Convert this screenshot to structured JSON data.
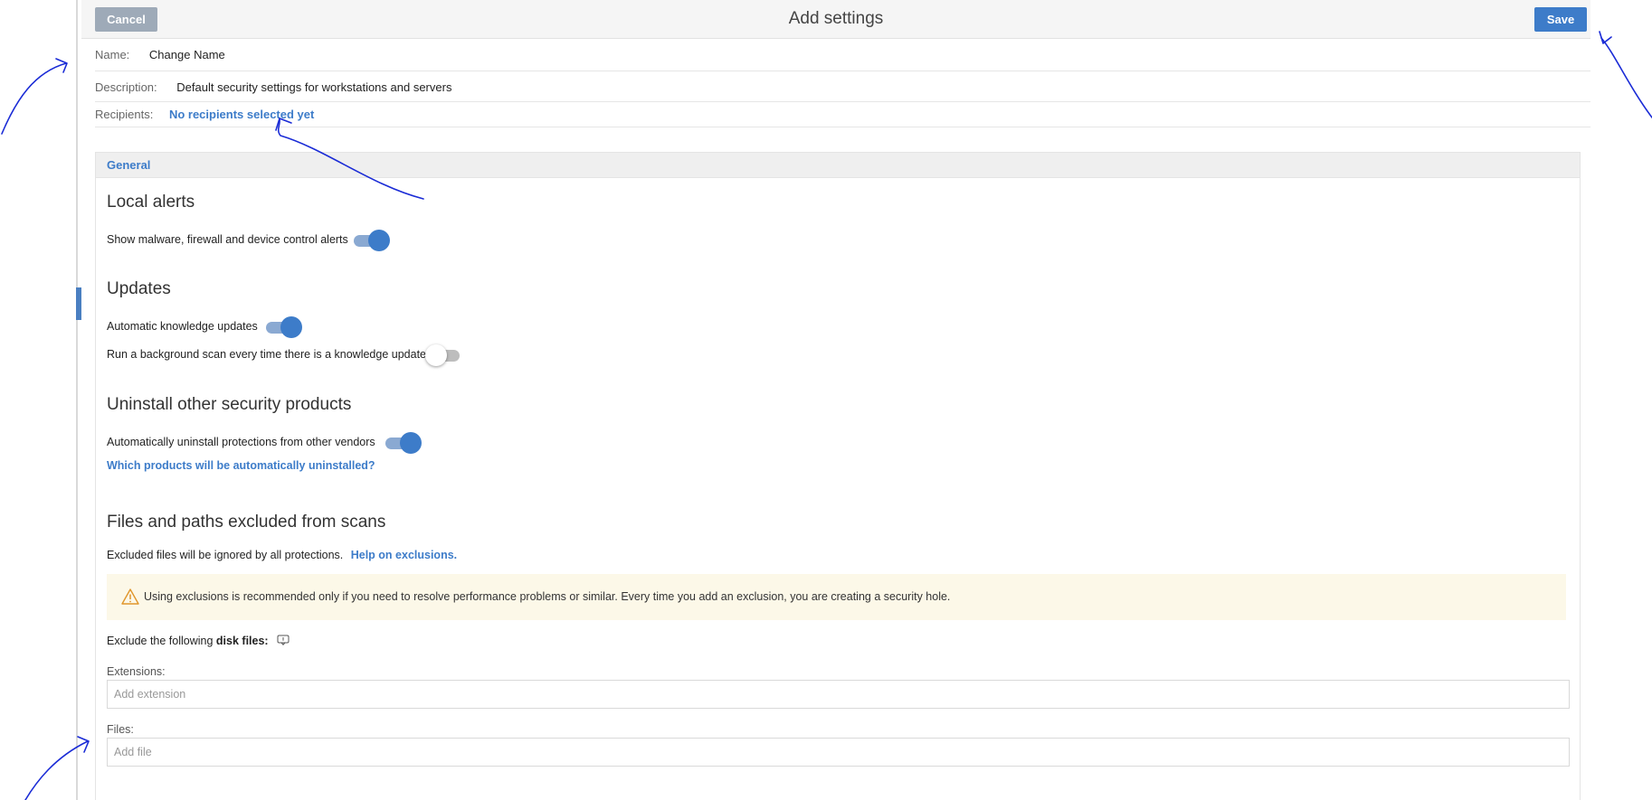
{
  "header": {
    "title": "Add settings",
    "cancel_label": "Cancel",
    "save_label": "Save"
  },
  "form": {
    "name_label": "Name:",
    "name_value": "Change Name",
    "description_label": "Description:",
    "description_value": "Default security settings for workstations and servers",
    "recipients_label": "Recipients:",
    "recipients_link": "No recipients selected yet"
  },
  "general": {
    "tab_label": "General",
    "local_alerts": {
      "heading": "Local alerts",
      "show_alerts_label": "Show malware, firewall and device control alerts",
      "show_alerts_on": true
    },
    "updates": {
      "heading": "Updates",
      "auto_updates_label": "Automatic knowledge updates",
      "auto_updates_on": true,
      "bg_scan_label": "Run a background scan every time there is a knowledge update",
      "bg_scan_on": false
    },
    "uninstall": {
      "heading": "Uninstall other security products",
      "auto_uninstall_label": "Automatically uninstall protections from other vendors",
      "auto_uninstall_on": true,
      "which_products_link": "Which products will be automatically uninstalled?"
    },
    "exclusions": {
      "heading": "Files and paths excluded from scans",
      "intro_text": "Excluded files will be ignored by all protections.",
      "help_link": "Help on exclusions.",
      "warning_text": "Using exclusions is recommended only if you need to resolve performance problems or similar. Every time you add an exclusion, you are creating a security hole.",
      "disk_files_prefix": "Exclude the following",
      "disk_files_bold": "disk files:",
      "extensions_label": "Extensions:",
      "extensions_placeholder": "Add extension",
      "files_label": "Files:",
      "files_placeholder": "Add file"
    }
  },
  "colors": {
    "accent": "#3d7cc9",
    "cancel_button": "#9eaab8",
    "warning_background": "#fcf8e8",
    "warning_icon": "#e0962b",
    "annotation_ink": "#1a2bd6"
  },
  "icons": [
    "warning-icon",
    "info-icon"
  ]
}
